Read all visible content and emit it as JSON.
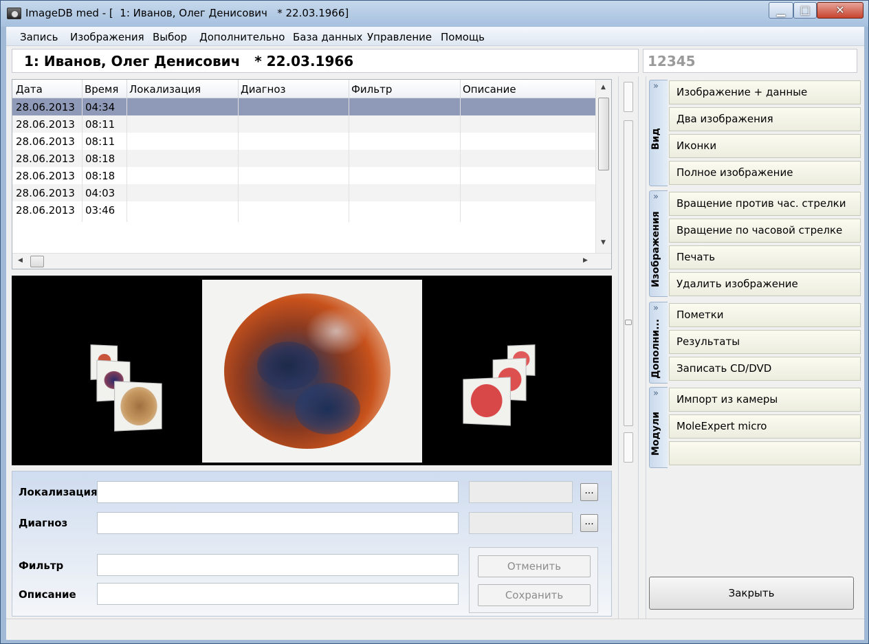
{
  "window": {
    "title": "ImageDB med - [  1: Иванов, Олег Денисович   * 22.03.1966]"
  },
  "menu": [
    "Запись",
    "Изображения",
    "Выбор",
    "Дополнительно",
    "База данных",
    "Управление",
    "Помощь"
  ],
  "patient": {
    "header": "1: Иванов, Олег Денисович   * 22.03.1966",
    "id": "12345"
  },
  "table": {
    "columns": [
      "Дата",
      "Время",
      "Локализация",
      "Диагноз",
      "Фильтр",
      "Описание"
    ],
    "rows": [
      {
        "date": "28.06.2013",
        "time": "04:34"
      },
      {
        "date": "28.06.2013",
        "time": "08:11"
      },
      {
        "date": "28.06.2013",
        "time": "08:11"
      },
      {
        "date": "28.06.2013",
        "time": "08:18"
      },
      {
        "date": "28.06.2013",
        "time": "08:18"
      },
      {
        "date": "28.06.2013",
        "time": "04:03"
      },
      {
        "date": "28.06.2013",
        "time": "03:46"
      }
    ],
    "selected_index": 0
  },
  "form": {
    "loc_label": "Локализация",
    "diag_label": "Диагноз",
    "filter_label": "Фильтр",
    "desc_label": "Описание",
    "browse_label": "...",
    "cancel_label": "Отменить",
    "save_label": "Сохранить"
  },
  "panel": {
    "groups": [
      {
        "title": "Вид",
        "items": [
          "Изображение + данные",
          "Два изображения",
          "Иконки",
          "Полное изображение"
        ]
      },
      {
        "title": "Изображения",
        "items": [
          "Вращение против час. стрелки",
          "Вращение по часовой стрелке",
          "Печать",
          "Удалить изображение"
        ]
      },
      {
        "title": "Дополни...",
        "items": [
          "Пометки",
          "Результаты",
          "Записать CD/DVD"
        ]
      },
      {
        "title": "Модули",
        "items": [
          "Импорт из камеры",
          "MoleExpert micro",
          ""
        ]
      }
    ],
    "close_label": "Закрыть"
  }
}
